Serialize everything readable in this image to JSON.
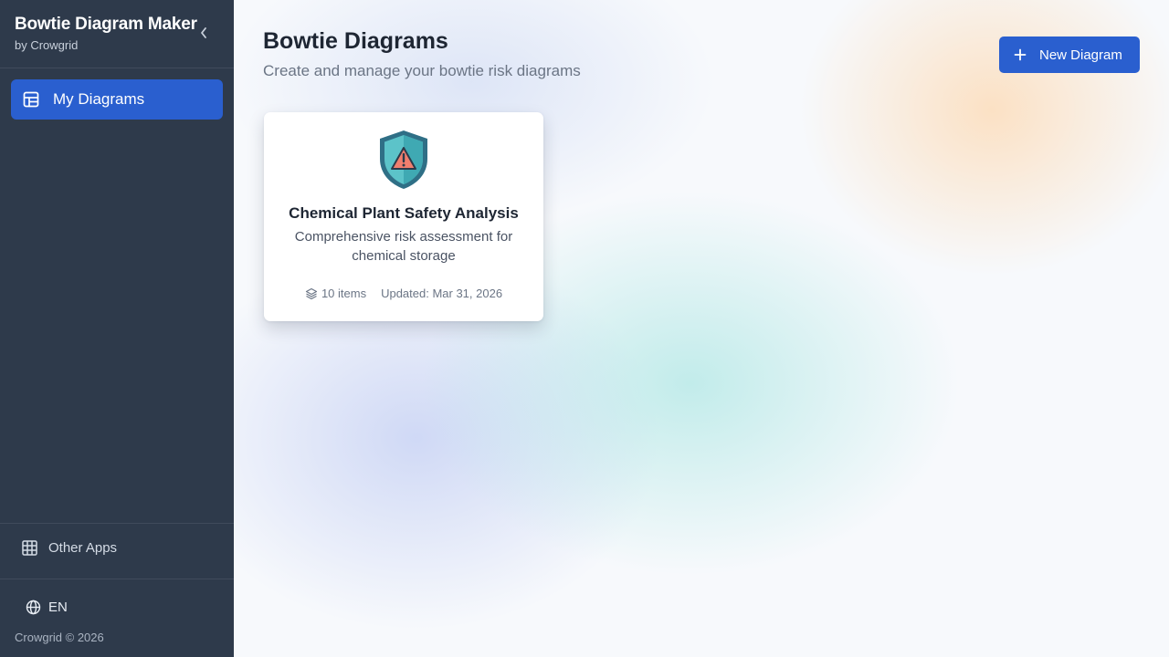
{
  "sidebar": {
    "app_title": "Bowtie Diagram Maker",
    "app_subtitle": "by Crowgrid",
    "collapse_icon": "chevron-left-icon",
    "nav": [
      {
        "label": "My Diagrams",
        "icon": "layout-icon",
        "active": true
      }
    ],
    "other_apps_label": "Other Apps",
    "language": "EN",
    "copyright": "Crowgrid © 2026"
  },
  "header": {
    "title": "Bowtie Diagrams",
    "subtitle": "Create and manage your bowtie risk diagrams",
    "new_button_label": "New Diagram"
  },
  "diagrams": [
    {
      "title": "Chemical Plant Safety Analysis",
      "description": "Comprehensive risk assessment for chemical storage",
      "items": "10 items",
      "updated": "Updated: Mar 31, 2026",
      "icon": "shield-warning-icon"
    }
  ],
  "colors": {
    "sidebar_bg": "#2e3a4b",
    "accent": "#2a5fcf"
  }
}
